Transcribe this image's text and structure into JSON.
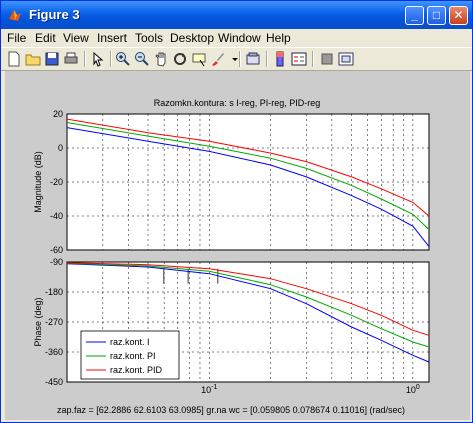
{
  "window": {
    "title": "Figure 3",
    "controls": [
      "_",
      "□",
      "✕"
    ]
  },
  "menu": [
    "File",
    "Edit",
    "View",
    "Insert",
    "Tools",
    "Desktop",
    "Window",
    "Help"
  ],
  "toolbar_icons": [
    "new-file-icon",
    "open-folder-icon",
    "save-icon",
    "print-icon",
    "pointer-icon",
    "zoom-in-icon",
    "zoom-out-icon",
    "pan-icon",
    "rotate-3d-icon",
    "data-cursor-icon",
    "brush-icon",
    "link-icon",
    "colorbar-icon",
    "legend-icon",
    "hide-plot-tools-icon",
    "show-plot-tools-icon"
  ],
  "figure": {
    "title": "Razomkn.kontura:    s  I-reg,    PI-reg,    PID-reg",
    "status_line": "zap.faz = [62.2886       62.6103       63.0985] gr.na wc = [0.059805      0.078674      0.11016]  (rad/sec)"
  },
  "chart_data": [
    {
      "type": "line",
      "ylabel": "Magnitude (dB)",
      "xscale": "log",
      "xlim": [
        0.02,
        1.2
      ],
      "ylim": [
        -60,
        20
      ],
      "yticks": [
        "20",
        "0",
        "-20",
        "-40",
        "-60"
      ],
      "grid": true,
      "x": [
        0.02,
        0.05,
        0.1,
        0.2,
        0.3,
        0.5,
        0.7,
        1.0,
        1.2
      ],
      "series": [
        {
          "name": "raz.kont. I",
          "color": "#0000ff",
          "values": [
            12,
            4,
            -2,
            -10,
            -17,
            -28,
            -36,
            -46,
            -58
          ]
        },
        {
          "name": "raz.kont. PI",
          "color": "#00aa00",
          "values": [
            15,
            7,
            1,
            -6,
            -12,
            -22,
            -30,
            -39,
            -48
          ]
        },
        {
          "name": "raz.kont. PID",
          "color": "#ff0000",
          "values": [
            17,
            9,
            4,
            -3,
            -8,
            -17,
            -24,
            -32,
            -40
          ]
        }
      ]
    },
    {
      "type": "line",
      "ylabel": "Phase (deg)",
      "xscale": "log",
      "xlim": [
        0.02,
        1.2
      ],
      "ylim": [
        -450,
        -90
      ],
      "yticks": [
        "-90",
        "-180",
        "-270",
        "-360",
        "-450"
      ],
      "xticks": [
        "10^-1",
        "10^0"
      ],
      "grid": true,
      "legend": "bottom-left",
      "x": [
        0.02,
        0.05,
        0.1,
        0.2,
        0.3,
        0.5,
        0.7,
        1.0,
        1.2
      ],
      "series": [
        {
          "name": "raz.kont. I",
          "color": "#0000ff",
          "values": [
            -95,
            -105,
            -125,
            -170,
            -215,
            -285,
            -325,
            -370,
            -390
          ]
        },
        {
          "name": "raz.kont. PI",
          "color": "#00aa00",
          "values": [
            -94,
            -102,
            -118,
            -158,
            -195,
            -250,
            -290,
            -330,
            -345
          ]
        },
        {
          "name": "raz.kont. PID",
          "color": "#ff0000",
          "values": [
            -92,
            -98,
            -110,
            -140,
            -170,
            -215,
            -250,
            -295,
            -310
          ]
        }
      ],
      "margin_markers_x": [
        0.059805,
        0.078674,
        0.11016
      ]
    }
  ]
}
